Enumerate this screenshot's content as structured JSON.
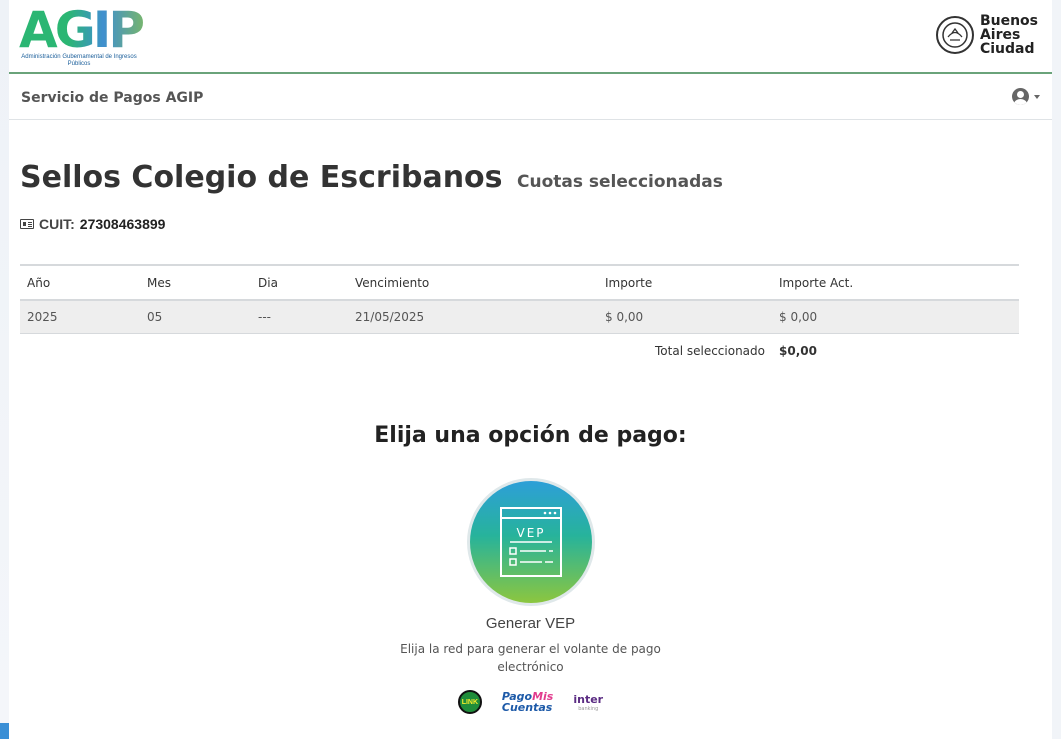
{
  "header": {
    "logo_text": "AGIP",
    "logo_subtitle": "Administración Gubernamental de Ingresos Públicos",
    "city_logo": [
      "Buenos",
      "Aires",
      "Ciudad"
    ]
  },
  "navbar": {
    "brand": "Servicio de Pagos AGIP",
    "user_icon": "user-circle-icon"
  },
  "page": {
    "title": "Sellos Colegio de Escribanos",
    "subtitle": "Cuotas seleccionadas",
    "cuit_label": "CUIT:",
    "cuit_value": "27308463899"
  },
  "table": {
    "headers": [
      "Año",
      "Mes",
      "Dia",
      "Vencimiento",
      "Importe",
      "Importe Act."
    ],
    "rows": [
      [
        "2025",
        "05",
        "---",
        "21/05/2025",
        "$ 0,00",
        "$ 0,00"
      ]
    ],
    "total_label": "Total seleccionado",
    "total_value": "$0,00"
  },
  "payment": {
    "heading": "Elija una opción de pago:",
    "vep_icon_text": "VEP",
    "vep_label": "Generar VEP",
    "vep_description": "Elija la red para generar el volante de pago electrónico",
    "networks": {
      "link": "LINK",
      "pmc_1": "Pago",
      "pmc_2": "Mis",
      "pmc_3": "Cuentas",
      "inter": "inter",
      "inter_sub": "banking"
    }
  },
  "colors": {
    "accent_green": "#6aa37a",
    "vep_gradient": [
      "#2d9fd8",
      "#27b39b",
      "#8cc63f"
    ]
  }
}
